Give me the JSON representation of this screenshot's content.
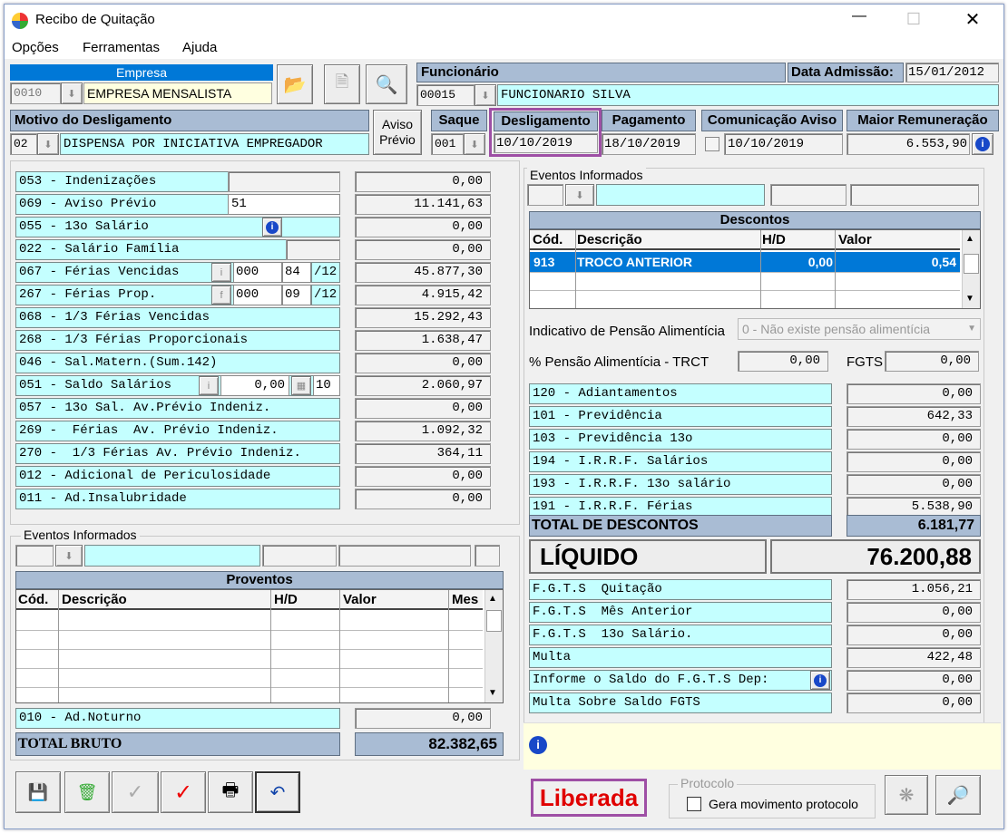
{
  "window": {
    "title": "Recibo de Quitação"
  },
  "menu": [
    "Opções",
    "Ferramentas",
    "Ajuda"
  ],
  "empresa": {
    "label": "Empresa",
    "code": "0010",
    "name": "EMPRESA MENSALISTA"
  },
  "funcionario": {
    "label": "Funcionário",
    "code": "00015",
    "name": "FUNCIONARIO SILVA"
  },
  "admissao": {
    "label": "Data Admissão:",
    "value": "15/01/2012"
  },
  "motivo": {
    "label": "Motivo do Desligamento",
    "code": "02",
    "value": "DISPENSA POR INICIATIVA EMPREGADOR"
  },
  "aviso_previo": {
    "line1": "Aviso",
    "line2": "Prévio"
  },
  "saque": {
    "label": "Saque",
    "code": "001"
  },
  "desligamento": {
    "label": "Desligamento",
    "value": "10/10/2019"
  },
  "pagamento": {
    "label": "Pagamento",
    "value": "18/10/2019"
  },
  "comunicacao": {
    "label": "Comunicação Aviso",
    "value": "10/10/2019"
  },
  "maior_remuneracao": {
    "label": "Maior Remuneração",
    "value": "6.553,90"
  },
  "proventos_rows": [
    {
      "label": "053 - Indenizações",
      "value": "0,00"
    },
    {
      "label": "069 - Aviso Prévio",
      "extra": "51",
      "value": "11.141,63"
    },
    {
      "label": "055 - 13o Salário",
      "value": "0,00"
    },
    {
      "label": "022 - Salário Família",
      "value": "0,00"
    },
    {
      "label": "067 - Férias Vencidas",
      "a": "000",
      "b": "84",
      "c": "/12",
      "value": "45.877,30"
    },
    {
      "label": "267 - Férias Prop.",
      "a": "000",
      "b": "09",
      "c": "/12",
      "value": "4.915,42"
    },
    {
      "label": "068 - 1/3 Férias Vencidas",
      "value": "15.292,43"
    },
    {
      "label": "268 - 1/3 Férias Proporcionais",
      "value": "1.638,47"
    },
    {
      "label": "046 - Sal.Matern.(Sum.142)",
      "value": "0,00"
    },
    {
      "label": "051 - Saldo Salários",
      "a": "0,00",
      "b": "10",
      "value": "2.060,97"
    },
    {
      "label": "057 - 13o Sal. Av.Prévio Indeniz.",
      "value": "0,00"
    },
    {
      "label": "269 -  Férias  Av. Prévio Indeniz.",
      "value": "1.092,32"
    },
    {
      "label": "270 -  1/3 Férias Av. Prévio Indeniz.",
      "value": "364,11"
    },
    {
      "label": "012 - Adicional de Periculosidade",
      "value": "0,00"
    },
    {
      "label": "011 - Ad.Insalubridade",
      "value": "0,00"
    }
  ],
  "eventos_informados_label": "Eventos Informados",
  "proventos_grid": {
    "title": "Proventos",
    "cols": [
      "Cód.",
      "Descrição",
      "H/D",
      "Valor",
      "Mes"
    ]
  },
  "ad_noturno": {
    "label": "010 - Ad.Noturno",
    "value": "0,00"
  },
  "total_bruto": {
    "label": "TOTAL BRUTO",
    "value": "82.382,65"
  },
  "descontos_grid": {
    "title": "Descontos",
    "cols": [
      "Cód.",
      "Descrição",
      "H/D",
      "Valor"
    ],
    "rows": [
      {
        "cod": "913",
        "desc": "TROCO ANTERIOR",
        "hd": "0,00",
        "valor": "0,54"
      }
    ]
  },
  "pensao": {
    "label": "Indicativo de Pensão Alimentícia",
    "value": "0 - Não existe pensão alimentícia"
  },
  "pct_pensao": {
    "label": "% Pensão Alimentícia - TRCT",
    "value": "0,00"
  },
  "fgts": {
    "label": "FGTS",
    "value": "0,00"
  },
  "descontos_rows": [
    {
      "label": "120 - Adiantamentos",
      "value": "0,00"
    },
    {
      "label": "101 - Previdência",
      "value": "642,33"
    },
    {
      "label": "103 - Previdência 13o",
      "value": "0,00"
    },
    {
      "label": "194 - I.R.R.F. Salários",
      "value": "0,00"
    },
    {
      "label": "193 - I.R.R.F. 13o salário",
      "value": "0,00"
    },
    {
      "label": "191 - I.R.R.F. Férias",
      "value": "5.538,90"
    }
  ],
  "total_descontos": {
    "label": "TOTAL DE DESCONTOS",
    "value": "6.181,77"
  },
  "liquido": {
    "label": "LÍQUIDO",
    "value": "76.200,88"
  },
  "fgts_rows": [
    {
      "label": "F.G.T.S  Quitação",
      "value": "1.056,21"
    },
    {
      "label": "F.G.T.S  Mês Anterior",
      "value": "0,00"
    },
    {
      "label": "F.G.T.S  13o Salário.",
      "value": "0,00"
    },
    {
      "label": "Multa",
      "value": "422,48"
    },
    {
      "label": "Informe o Saldo do F.G.T.S Dep:",
      "value": "0,00"
    },
    {
      "label": "Multa Sobre Saldo FGTS",
      "value": "0,00"
    }
  ],
  "status": "Liberada",
  "protocolo": {
    "label": "Protocolo",
    "checkbox": "Gera movimento protocolo"
  },
  "colors": {
    "cyan": "#c4ffff",
    "header": "#a9bcd4",
    "highlight": "#9e4fa5",
    "status_red": "#e00000",
    "selection": "#0078d7"
  }
}
